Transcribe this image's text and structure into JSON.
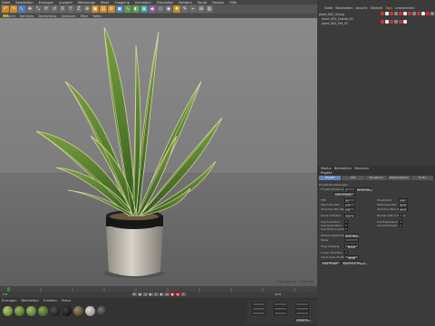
{
  "menu": [
    "Datei",
    "Bearbeiten",
    "Erzeugen",
    "Auswahl",
    "Werkzeuge",
    "Mesh",
    "Snapping",
    "Animation",
    "Simulation",
    "Rendern",
    "Skript",
    "Fenster",
    "Hilfe"
  ],
  "viewport": {
    "menu": [
      "Ansicht",
      "Kameras",
      "Darstellung",
      "Optionen",
      "Filter",
      "Tafeln"
    ],
    "label": "Zentralperspektive",
    "info": "Grid Spacing : 1000 cm"
  },
  "objects": {
    "tabs": [
      "Datei",
      "Bearbeiten",
      "Ansicht",
      "Objekte",
      "Tags",
      "Lesezeichen"
    ],
    "active_tab": "Tags",
    "rows": [
      "plant_002_Group",
      "plant_002_Leaves_01",
      "plant_002_Pot_01"
    ]
  },
  "attributes": {
    "title": "Projekt",
    "tabs": [
      "Projekt",
      "Info",
      "Dynamics",
      "Referenzieren",
      "To Do"
    ],
    "active_tab": "Projekt",
    "section": "Projekt-Einstellungen",
    "rows": [
      {
        "label": "Projekt-Skalierung",
        "value": "1",
        "unit": "Zentimeter"
      },
      {
        "label": "FPS",
        "value": "30"
      },
      {
        "label": "Minimale Zeit",
        "value": "0 B"
      },
      {
        "label": "Vorschau-Min-Zeit",
        "value": "0 B"
      },
      {
        "label": "Level of Detail",
        "value": "100 %"
      },
      {
        "label": "Use Animation",
        "value": ""
      },
      {
        "label": "Use Expression",
        "value": ""
      },
      {
        "label": "Use Generators",
        "value": ""
      },
      {
        "label": "Use Deformers",
        "value": ""
      },
      {
        "label": "Use Motion System",
        "value": ""
      },
      {
        "label": "Defaut-Objekt-Farbe",
        "value": "Grau-Blau"
      },
      {
        "label": "Farbe",
        "value": ""
      },
      {
        "label": "View Clipping",
        "value": "Mittel"
      },
      {
        "label": "Linear Workflow",
        "value": ""
      },
      {
        "label": "Input Color Profile",
        "value": "sRGB"
      }
    ],
    "right_rows": [
      {
        "label": "Projektzeit",
        "value": "0 B"
      },
      {
        "label": "Maximale Zeit",
        "value": "90 B"
      },
      {
        "label": "Vorschau-Max-Zeit",
        "value": "90 B"
      },
      {
        "label": "Render LOD in Editor",
        "value": ""
      }
    ],
    "buttons": [
      "Lade Preset...",
      "Speichere Preset..."
    ]
  },
  "timeline": {
    "frame_start": "0 B",
    "frame_end": "90 B"
  },
  "materials": {
    "menu": [
      "Erzeugen",
      "Bearbeiten",
      "Funktion",
      "Textur"
    ],
    "count": 9
  },
  "coords": {
    "labels": [
      "X",
      "Y",
      "Z",
      "H",
      "P",
      "B"
    ],
    "apply": "Anwenden"
  }
}
